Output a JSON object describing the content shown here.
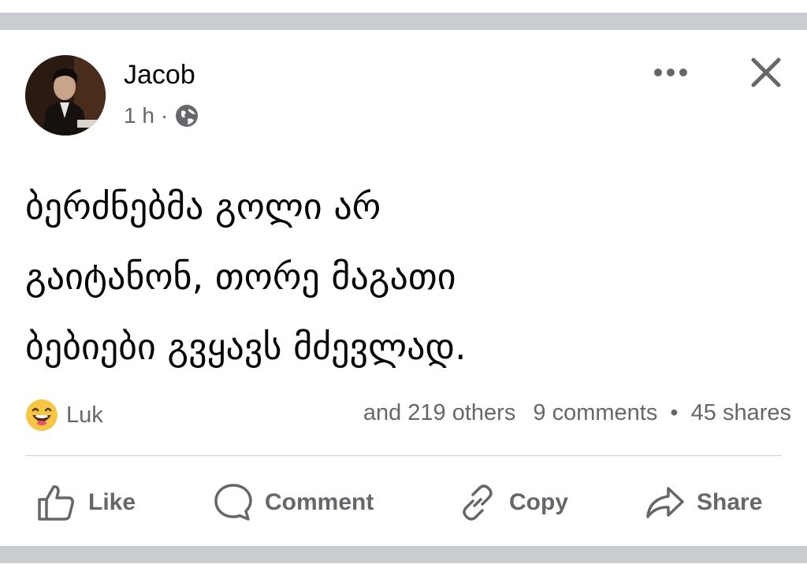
{
  "post": {
    "author": "Jacob",
    "time": "1 h",
    "separator": "·",
    "privacy_icon": "globe-icon",
    "text_lines": [
      "ბერძნებმა გოლი არ",
      "გაიტანონ, თორე მაგათი",
      "ბებიები გვყავს მძევლად."
    ]
  },
  "engagement": {
    "reaction_emoji": "laughing-emoji-icon",
    "reaction_name": "Luk",
    "others": "and 219 others",
    "comments": "9 comments",
    "bullet": "•",
    "shares": "45 shares"
  },
  "actions": {
    "like": "Like",
    "comment": "Comment",
    "copy": "Copy",
    "share": "Share"
  },
  "colors": {
    "text_primary": "#050505",
    "text_secondary": "#65676b",
    "frame_bar": "#c9ccd1",
    "divider": "#ced0d4"
  }
}
